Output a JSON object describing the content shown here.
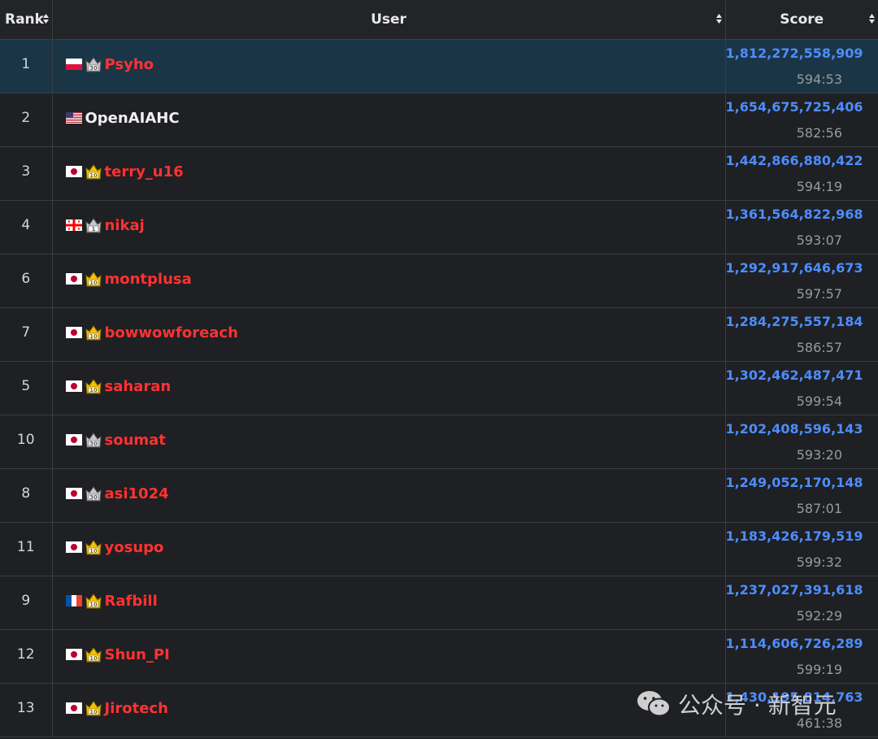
{
  "header": {
    "rank": "Rank",
    "user": "User",
    "score": "Score"
  },
  "rows": [
    {
      "rank": "1",
      "flag": "pl",
      "crown": "silver-30",
      "name": "Psyho",
      "name_color": "red",
      "score": "1,812,272,558,909",
      "time": "594:53",
      "highlight": true
    },
    {
      "rank": "2",
      "flag": "us",
      "crown": "",
      "name": "OpenAIAHC",
      "name_color": "white",
      "score": "1,654,675,725,406",
      "time": "582:56"
    },
    {
      "rank": "3",
      "flag": "jp",
      "crown": "gold-10",
      "name": "terry_u16",
      "name_color": "red",
      "score": "1,442,866,880,422",
      "time": "594:19"
    },
    {
      "rank": "4",
      "flag": "ge",
      "crown": "silver-1",
      "name": "nikaj",
      "name_color": "red",
      "score": "1,361,564,822,968",
      "time": "593:07"
    },
    {
      "rank": "6",
      "flag": "jp",
      "crown": "gold-10",
      "name": "montplusa",
      "name_color": "red",
      "score": "1,292,917,646,673",
      "time": "597:57"
    },
    {
      "rank": "7",
      "flag": "jp",
      "crown": "gold-10",
      "name": "bowwowforeach",
      "name_color": "red",
      "score": "1,284,275,557,184",
      "time": "586:57"
    },
    {
      "rank": "5",
      "flag": "jp",
      "crown": "gold-10",
      "name": "saharan",
      "name_color": "red",
      "score": "1,302,462,487,471",
      "time": "599:54"
    },
    {
      "rank": "10",
      "flag": "jp",
      "crown": "silver-30",
      "name": "soumat",
      "name_color": "red",
      "score": "1,202,408,596,143",
      "time": "593:20"
    },
    {
      "rank": "8",
      "flag": "jp",
      "crown": "silver-30",
      "name": "asi1024",
      "name_color": "red",
      "score": "1,249,052,170,148",
      "time": "587:01"
    },
    {
      "rank": "11",
      "flag": "jp",
      "crown": "gold-10",
      "name": "yosupo",
      "name_color": "red",
      "score": "1,183,426,179,519",
      "time": "599:32"
    },
    {
      "rank": "9",
      "flag": "fr",
      "crown": "gold-10",
      "name": "Rafbill",
      "name_color": "red",
      "score": "1,237,027,391,618",
      "time": "592:29"
    },
    {
      "rank": "12",
      "flag": "jp",
      "crown": "gold-10",
      "name": "Shun_PI",
      "name_color": "red",
      "score": "1,114,606,726,289",
      "time": "599:19"
    },
    {
      "rank": "13",
      "flag": "jp",
      "crown": "gold-10",
      "name": "Jirotech",
      "name_color": "red",
      "score": "1,430,195,814,763",
      "time": "461:38"
    }
  ],
  "watermark": {
    "text": "公众号 · 新智元",
    "icon": "wechat-icon"
  },
  "colors": {
    "name_red": "#ff3232",
    "score_blue": "#4d8dff",
    "highlight_row": "#1a3646"
  }
}
